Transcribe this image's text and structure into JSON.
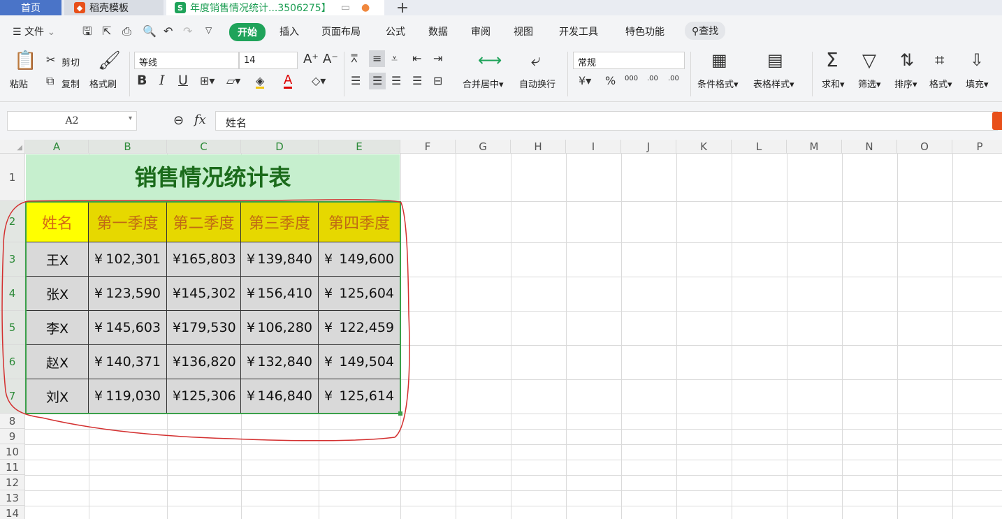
{
  "tabs": {
    "home": "首页",
    "template": "稻壳模板",
    "doc": "年度销售情况统计...3506275】",
    "new_tab": "+"
  },
  "menu": {
    "file": "文件",
    "items": [
      "开始",
      "插入",
      "页面布局",
      "公式",
      "数据",
      "审阅",
      "视图",
      "开发工具",
      "特色功能"
    ],
    "search": "查找"
  },
  "ribbon": {
    "paste": "粘贴",
    "cut": "剪切",
    "copy": "复制",
    "format_painter": "格式刷",
    "font_name": "等线",
    "font_size": "14",
    "bold": "B",
    "italic": "I",
    "underline": "U",
    "merge_center": "合并居中",
    "wrap_text": "自动换行",
    "number_format": "常规",
    "currency": "¥",
    "percent": "%",
    "thousands": "000",
    "inc_decimal": ".00",
    "dec_decimal": ".00",
    "cond_format": "条件格式",
    "table_style": "表格样式",
    "sum": "求和",
    "filter": "筛选",
    "sort": "排序",
    "format": "格式",
    "fill": "填充"
  },
  "formula_bar": {
    "cell_ref": "A2",
    "fx": "fx",
    "content": "姓名"
  },
  "columns": [
    "A",
    "B",
    "C",
    "D",
    "E",
    "F",
    "G",
    "H",
    "I",
    "J",
    "K",
    "L",
    "M",
    "N",
    "O",
    "P"
  ],
  "rows": [
    "1",
    "2",
    "3",
    "4",
    "5",
    "6",
    "7",
    "8",
    "9",
    "10",
    "11",
    "12",
    "13",
    "14"
  ],
  "sheet": {
    "title": "销售情况统计表",
    "headers": [
      "姓名",
      "第一季度",
      "第二季度",
      "第三季度",
      "第四季度"
    ],
    "currency_symbol": "¥",
    "data": [
      {
        "name": "王X",
        "q": [
          "102,301",
          "165,803",
          "139,840",
          "149,600"
        ]
      },
      {
        "name": "张X",
        "q": [
          "123,590",
          "145,302",
          "156,410",
          "125,604"
        ]
      },
      {
        "name": "李X",
        "q": [
          "145,603",
          "179,530",
          "106,280",
          "122,459"
        ]
      },
      {
        "name": "赵X",
        "q": [
          "140,371",
          "136,820",
          "132,840",
          "149,504"
        ]
      },
      {
        "name": "刘X",
        "q": [
          "119,030",
          "125,306",
          "146,840",
          "125,614"
        ]
      }
    ]
  },
  "colors": {
    "accent": "#1fa35a",
    "title_fill": "#c6efce",
    "header_fill": "#e6d800",
    "data_fill": "#d9d9d9",
    "annotation": "#d32f2f"
  }
}
